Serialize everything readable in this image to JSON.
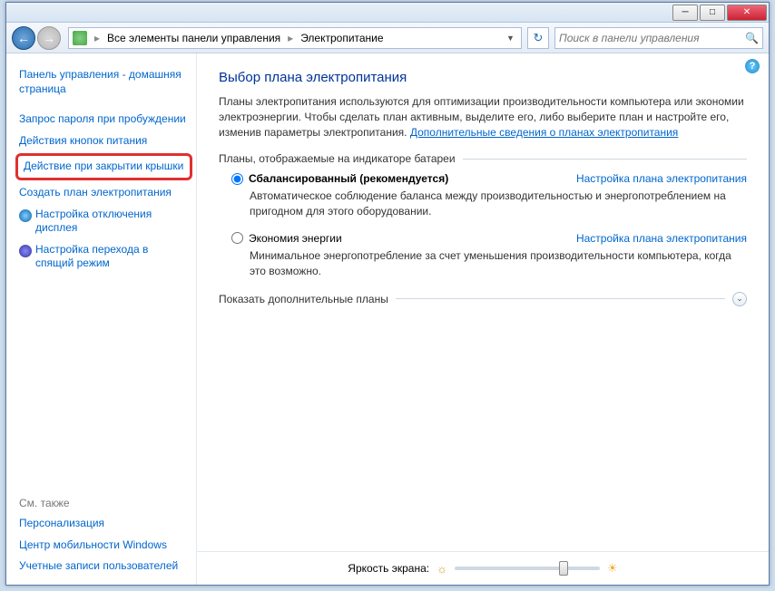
{
  "breadcrumb": {
    "seg1": "Все элементы панели управления",
    "seg2": "Электропитание"
  },
  "search": {
    "placeholder": "Поиск в панели управления"
  },
  "sidebar": {
    "home": "Панель управления - домашняя страница",
    "l1": "Запрос пароля при пробуждении",
    "l2": "Действия кнопок питания",
    "l3": "Действие при закрытии крышки",
    "l4": "Создать план электропитания",
    "l5": "Настройка отключения дисплея",
    "l6": "Настройка перехода в спящий режим",
    "seealso": "См. также",
    "s1": "Персонализация",
    "s2": "Центр мобильности Windows",
    "s3": "Учетные записи пользователей"
  },
  "main": {
    "title": "Выбор плана электропитания",
    "intro": "Планы электропитания используются для оптимизации производительности компьютера или экономии электроэнергии. Чтобы сделать план активным, выделите его, либо выберите план и настройте его, изменив параметры электропитания. ",
    "introlink": "Дополнительные сведения о планах электропитания",
    "group": "Планы, отображаемые на индикаторе батареи",
    "plan1": {
      "name": "Сбалансированный (рекомендуется)",
      "cfg": "Настройка плана электропитания",
      "desc": "Автоматическое соблюдение баланса между производительностью и энергопотреблением на пригодном для этого оборудовании."
    },
    "plan2": {
      "name": "Экономия энергии",
      "cfg": "Настройка плана электропитания",
      "desc": "Минимальное энергопотребление за счет уменьшения производительности компьютера, когда это возможно."
    },
    "expand": "Показать дополнительные планы",
    "brightness": "Яркость экрана:"
  }
}
